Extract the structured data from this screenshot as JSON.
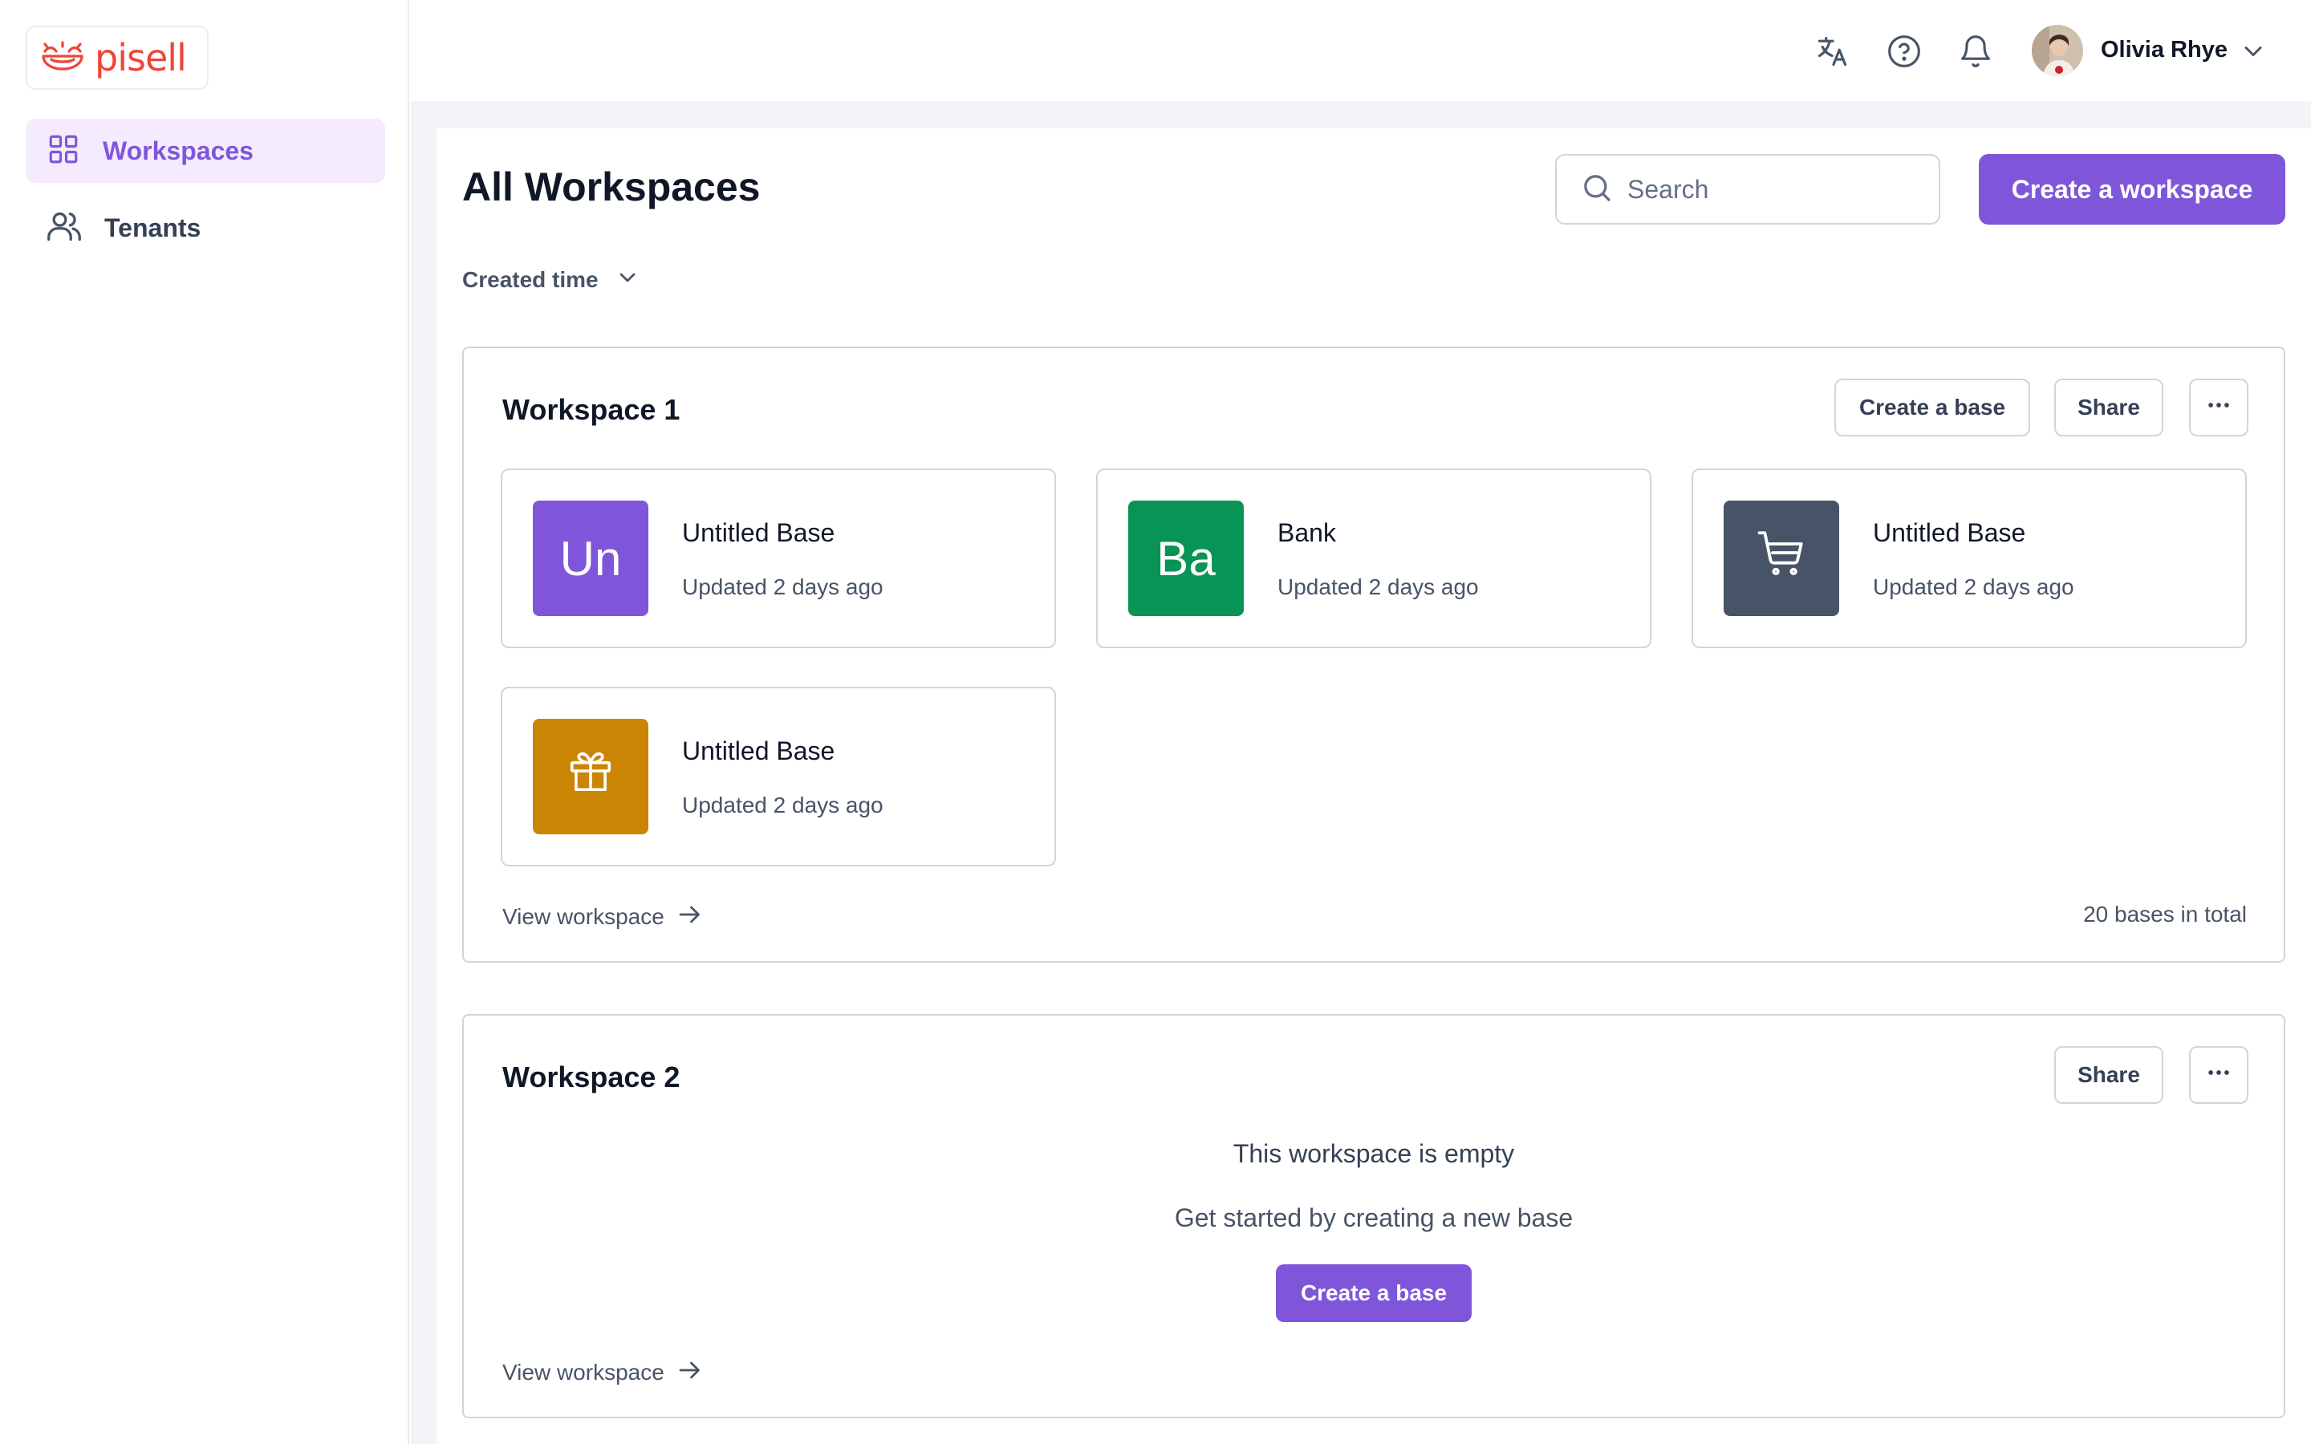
{
  "brand": {
    "name": "pisell",
    "color": "#f04438",
    "logo_icon": "smile-logo-icon"
  },
  "sidebar": {
    "items": [
      {
        "label": "Workspaces",
        "icon": "grid-icon",
        "active": true
      },
      {
        "label": "Tenants",
        "icon": "users-icon",
        "active": false
      }
    ]
  },
  "topbar": {
    "icons": [
      "translate-icon",
      "help-circle-icon",
      "bell-icon"
    ],
    "user": {
      "name": "Olivia Rhye",
      "avatar": "user-avatar"
    }
  },
  "main": {
    "title": "All Workspaces",
    "search": {
      "placeholder": "Search",
      "value": ""
    },
    "create_workspace_label": "Create a workspace",
    "sort": {
      "label": "Created time"
    }
  },
  "workspaces": [
    {
      "name": "Workspace 1",
      "actions": {
        "create_base": "Create a base",
        "share": "Share",
        "more": "more-horizontal-icon"
      },
      "bases": [
        {
          "name": "Untitled Base",
          "updated": "Updated 2 days ago",
          "tile_text": "Un",
          "tile_color": "#7f56d9"
        },
        {
          "name": "Bank",
          "updated": "Updated 2 days ago",
          "tile_text": "Ba",
          "tile_color": "#079455"
        },
        {
          "name": "Untitled Base",
          "updated": "Updated 2 days ago",
          "tile_icon": "shopping-cart-icon",
          "tile_color": "#475467"
        },
        {
          "name": "Untitled Base",
          "updated": "Updated 2 days ago",
          "tile_icon": "gift-icon",
          "tile_color": "#ca8504"
        }
      ],
      "view_label": "View workspace",
      "total": "20 bases in total"
    },
    {
      "name": "Workspace 2",
      "actions": {
        "share": "Share",
        "more": "more-horizontal-icon"
      },
      "empty": {
        "title": "This workspace is empty",
        "subtitle": "Get started by creating a new base",
        "button": "Create a base"
      },
      "view_label": "View workspace"
    }
  ],
  "colors": {
    "accent": "#7f56d9",
    "accent_light": "#f4ebff",
    "border": "#d0d5dd",
    "text_primary": "#101828",
    "text_secondary": "#475467"
  }
}
